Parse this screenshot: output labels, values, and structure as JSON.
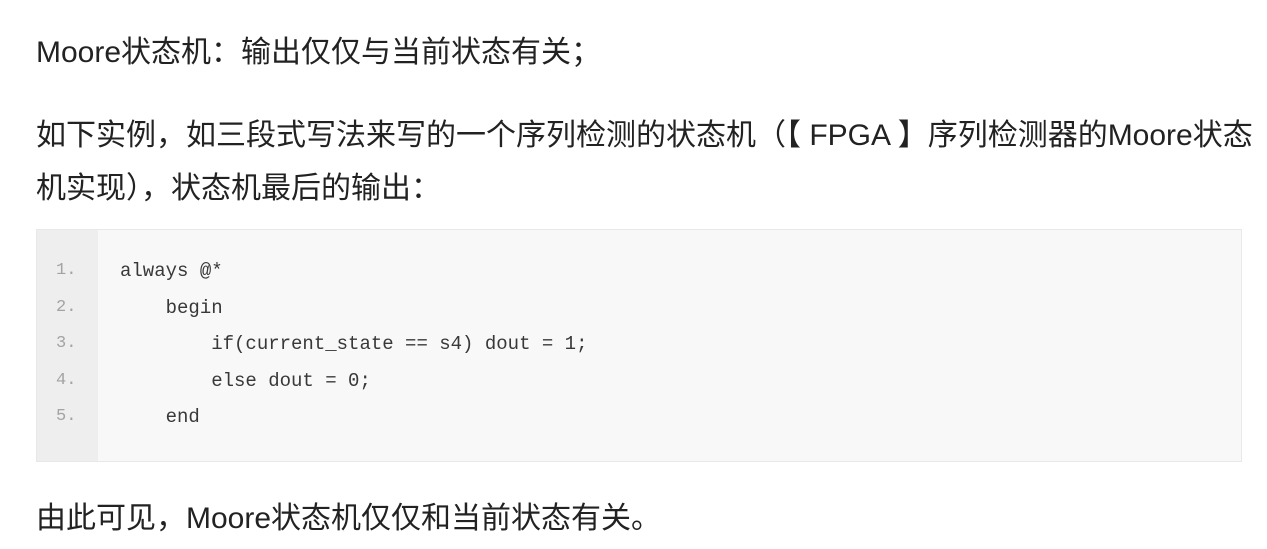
{
  "paragraphs": [
    "Moore状态机：输出仅仅与当前状态有关；",
    "如下实例，如三段式写法来写的一个序列检测的状态机（【 FPGA 】序列检测器的Moore状态机实现），状态机最后的输出：",
    "由此可见，Moore状态机仅仅和当前状态有关。"
  ],
  "code_block": {
    "line_numbers": [
      "1.",
      "2.",
      "3.",
      "4.",
      "5."
    ],
    "lines": [
      "always @*",
      "    begin",
      "        if(current_state == s4) dout = 1;",
      "        else dout = 0;",
      "    end"
    ]
  }
}
